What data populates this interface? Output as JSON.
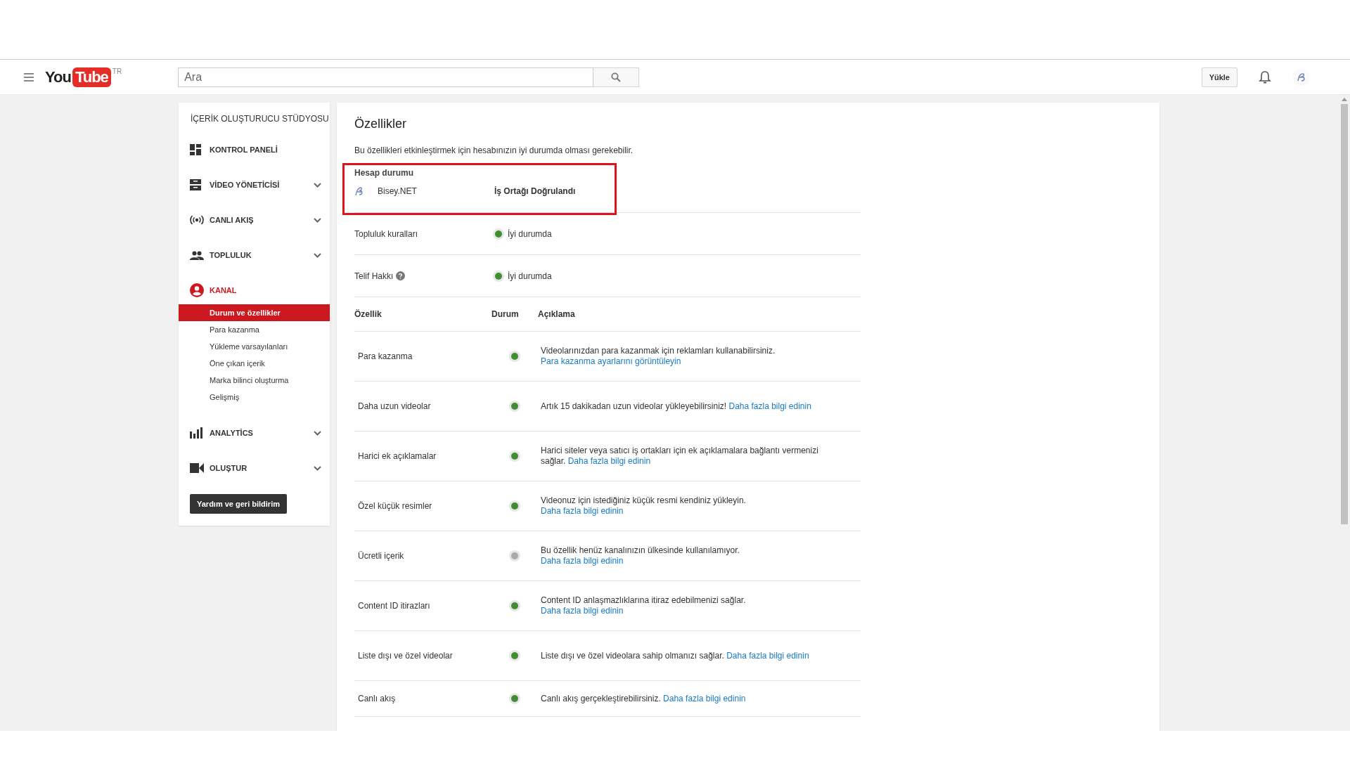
{
  "header": {
    "logo": {
      "you": "You",
      "tube": "Tube",
      "country": "TR"
    },
    "search": {
      "placeholder": "Ara"
    },
    "upload_button": "Yükle"
  },
  "sidebar": {
    "title": "İÇERİK OLUŞTURUCU STÜDYOSU",
    "items": [
      {
        "kind": "dashboard",
        "label": "KONTROL PANELİ",
        "expandable": false,
        "active": false
      },
      {
        "kind": "videos",
        "label": "VİDEO YÖNETİCİSİ",
        "expandable": true,
        "active": false
      },
      {
        "kind": "live",
        "label": "CANLI AKIŞ",
        "expandable": true,
        "active": false
      },
      {
        "kind": "community",
        "label": "TOPLULUK",
        "expandable": true,
        "active": false
      },
      {
        "kind": "channel",
        "label": "KANAL",
        "expandable": false,
        "active": true,
        "children": [
          {
            "label": "Durum ve özellikler",
            "selected": true
          },
          {
            "label": "Para kazanma",
            "selected": false
          },
          {
            "label": "Yükleme varsayılanları",
            "selected": false
          },
          {
            "label": "Öne çıkan içerik",
            "selected": false
          },
          {
            "label": "Marka bilinci oluşturma",
            "selected": false
          },
          {
            "label": "Gelişmiş",
            "selected": false
          }
        ]
      },
      {
        "kind": "analytics",
        "label": "ANALYTİCS",
        "expandable": true,
        "active": false
      },
      {
        "kind": "create",
        "label": "OLUŞTUR",
        "expandable": true,
        "active": false
      }
    ],
    "help_button": "Yardım ve geri bildirim"
  },
  "main": {
    "title": "Özellikler",
    "intro": "Bu özellikleri etkinleştirmek için hesabınızın iyi durumda olması gerekebilir.",
    "account": {
      "heading": "Hesap durumu",
      "channel": "Bisey.NET",
      "status": "İş Ortağı Doğrulandı"
    },
    "standing": [
      {
        "label": "Topluluk kuralları",
        "help": false,
        "status": "İyi durumda"
      },
      {
        "label": "Telif Hakkı",
        "help": true,
        "status": "İyi durumda"
      }
    ],
    "table": {
      "columns": [
        "Özellik",
        "Durum",
        "Açıklama"
      ],
      "rows": [
        {
          "feature": "Para kazanma",
          "enabled": true,
          "description": "Videolarınızdan para kazanmak için reklamları kullanabilirsiniz.",
          "link": "Para kazanma ayarlarını görüntüleyin"
        },
        {
          "feature": "Daha uzun videolar",
          "enabled": true,
          "description": "Artık 15 dakikadan uzun videolar yükleyebilirsiniz!",
          "link": "Daha fazla bilgi edinin"
        },
        {
          "feature": "Harici ek açıklamalar",
          "enabled": true,
          "description": "Harici siteler veya satıcı iş ortakları için ek açıklamalara bağlantı vermenizi sağlar.",
          "link": "Daha fazla bilgi edinin"
        },
        {
          "feature": "Özel küçük resimler",
          "enabled": true,
          "description": "Videonuz için istediğiniz küçük resmi kendiniz yükleyin.",
          "link": "Daha fazla bilgi edinin"
        },
        {
          "feature": "Ücretli içerik",
          "enabled": false,
          "description": "Bu özellik henüz kanalınızın ülkesinde kullanılamıyor.",
          "link": "Daha fazla bilgi edinin"
        },
        {
          "feature": "Content ID itirazları",
          "enabled": true,
          "description": "Content ID anlaşmazlıklarına itiraz edebilmenizi sağlar.",
          "link": "Daha fazla bilgi edinin"
        },
        {
          "feature": "Liste dışı ve özel videolar",
          "enabled": true,
          "description": "Liste dışı ve özel videolara sahip olmanızı sağlar.",
          "link": "Daha fazla bilgi edinin"
        },
        {
          "feature": "Canlı akış",
          "enabled": true,
          "description": "Canlı akış gerçekleştirebilirsiniz.",
          "link": "Daha fazla bilgi edinin"
        }
      ]
    }
  }
}
